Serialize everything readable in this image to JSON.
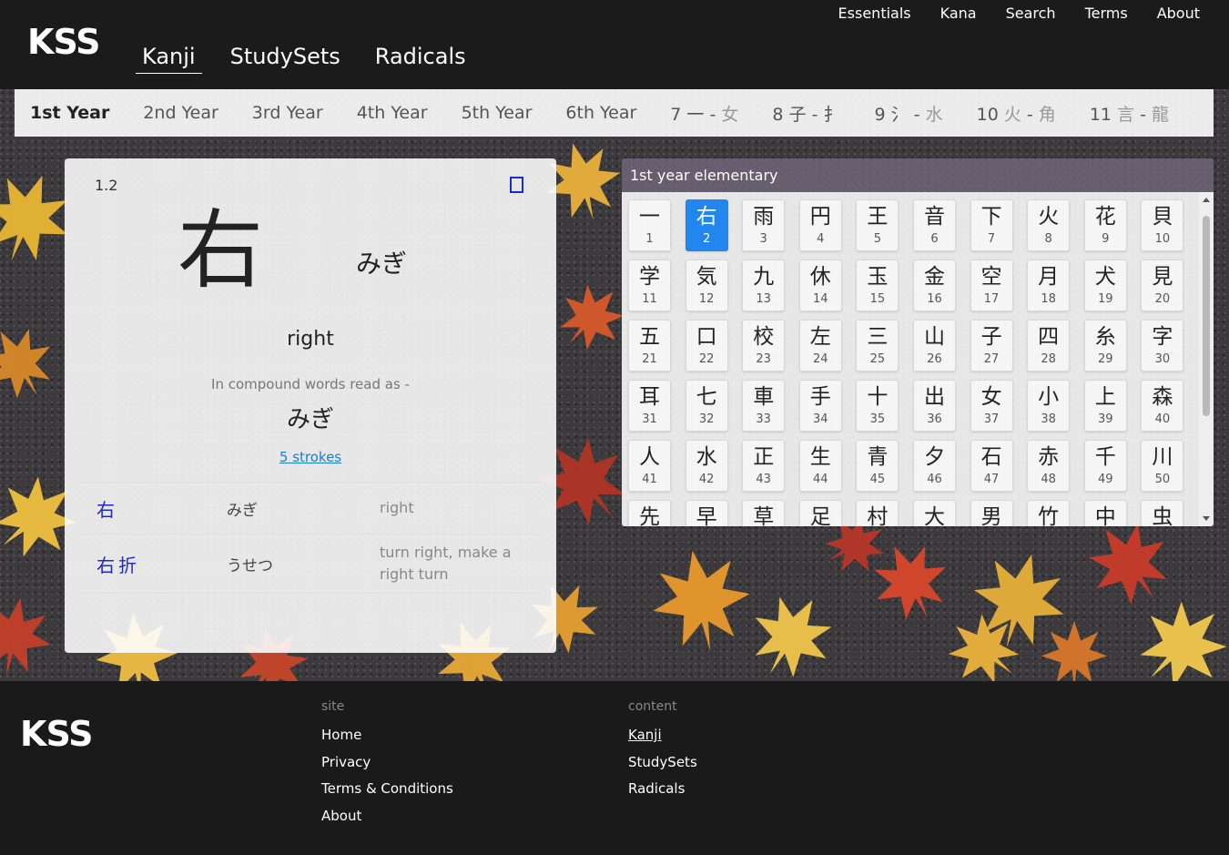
{
  "header": {
    "logo": "KSS",
    "top_links": [
      "Essentials",
      "Kana",
      "Search",
      "Terms",
      "About"
    ],
    "main_links": [
      {
        "label": "Kanji",
        "active": true
      },
      {
        "label": "StudySets",
        "active": false
      },
      {
        "label": "Radicals",
        "active": false
      }
    ]
  },
  "year_tabs": [
    {
      "label": "1st Year",
      "active": true
    },
    {
      "label": "2nd Year"
    },
    {
      "label": "3rd Year"
    },
    {
      "label": "4th Year"
    },
    {
      "label": "5th Year"
    },
    {
      "label": "6th Year"
    },
    {
      "num": "7",
      "from": "一",
      "to": "女"
    },
    {
      "num": "8",
      "from": "子",
      "to": "扌"
    },
    {
      "num": "9",
      "from": "氵",
      "to": "水"
    },
    {
      "num": "10",
      "from": "火",
      "to": "角"
    },
    {
      "num": "11",
      "from": "言",
      "to": "龍"
    }
  ],
  "detail": {
    "index": "1.2",
    "kanji": "右",
    "kun_reading": "みぎ",
    "meaning": "right",
    "compound_label": "In compound words read as -",
    "compound_reading": "みぎ",
    "strokes_link": "5 strokes",
    "words": [
      {
        "kanji": "右",
        "reading": "みぎ",
        "meaning": "right"
      },
      {
        "kanji": "右折",
        "reading": "うせつ",
        "meaning": "turn right, make a right turn"
      }
    ]
  },
  "grid_panel": {
    "title": "1st year elementary",
    "selected": 2,
    "kanji": [
      "一",
      "右",
      "雨",
      "円",
      "王",
      "音",
      "下",
      "火",
      "花",
      "貝",
      "学",
      "気",
      "九",
      "休",
      "玉",
      "金",
      "空",
      "月",
      "犬",
      "見",
      "五",
      "口",
      "校",
      "左",
      "三",
      "山",
      "子",
      "四",
      "糸",
      "字",
      "耳",
      "七",
      "車",
      "手",
      "十",
      "出",
      "女",
      "小",
      "上",
      "森",
      "人",
      "水",
      "正",
      "生",
      "青",
      "夕",
      "石",
      "赤",
      "千",
      "川",
      "先",
      "早",
      "草",
      "足",
      "村",
      "大",
      "男",
      "竹",
      "中",
      "虫"
    ]
  },
  "footer": {
    "logo": "KSS",
    "site_heading": "site",
    "site_links": [
      "Home",
      "Privacy",
      "Terms & Conditions",
      "About"
    ],
    "content_heading": "content",
    "content_links": [
      {
        "label": "Kanji",
        "active": true
      },
      {
        "label": "StudySets"
      },
      {
        "label": "Radicals"
      }
    ]
  },
  "colors": {
    "accent": "#2187ee",
    "link": "#1a7ed6",
    "word_kanji": "#1a2bc8",
    "header_bg": "#1c1b1b"
  }
}
